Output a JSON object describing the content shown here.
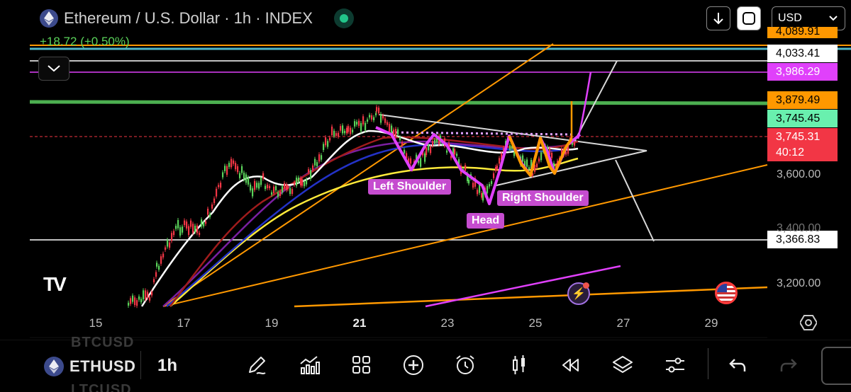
{
  "header": {
    "title": "Ethereum / U.S. Dollar · 1h · INDEX",
    "change": "+18.72 (+0.50%)",
    "currency": "USD"
  },
  "price_labels": [
    {
      "value": "4,033.41",
      "bg": "#ffffff",
      "fg": "#000000"
    },
    {
      "value": "3,986.29",
      "bg": "#e040fb",
      "fg": "#ffffff"
    },
    {
      "value": "3,879.49",
      "bg": "#ff9800",
      "fg": "#000000"
    },
    {
      "value": "3,745.45",
      "bg": "#69f0ae",
      "fg": "#000000"
    },
    {
      "value": "3,745.31",
      "bg": "#f23645",
      "fg": "#ffffff"
    },
    {
      "value": "40:12",
      "bg": "#f23645",
      "fg": "#ffffff"
    },
    {
      "value": "3,366.83",
      "bg": "#ffffff",
      "fg": "#000000"
    }
  ],
  "axis_labels": [
    "3,600.00",
    "3,400.00",
    "3,200.00"
  ],
  "partial_top_label": "4,089.91",
  "dates": [
    "15",
    "17",
    "19",
    "21",
    "23",
    "25",
    "27",
    "29"
  ],
  "bold_date": "21",
  "pattern_labels": {
    "left_shoulder": "Left Shoulder",
    "head": "Head",
    "right_shoulder": "Right Shoulder"
  },
  "bottom": {
    "symbol": "ETHUSD",
    "symbol_ghost_top": "BTCUSD",
    "symbol_ghost_bottom": "LTCUSD",
    "interval": "1h"
  },
  "toolbar_icons": [
    "drawing-pen-icon",
    "indicators-icon",
    "apps-grid-icon",
    "add-icon",
    "alert-clock-icon",
    "candles-icon",
    "replay-icon",
    "layers-icon",
    "settings-sliders-icon",
    "undo-icon",
    "redo-icon"
  ],
  "colors": {
    "green": "#4caf50",
    "orange": "#ff9800",
    "magenta": "#e040fb",
    "up_candle": "#5ad25a",
    "down_candle": "#f23645"
  }
}
